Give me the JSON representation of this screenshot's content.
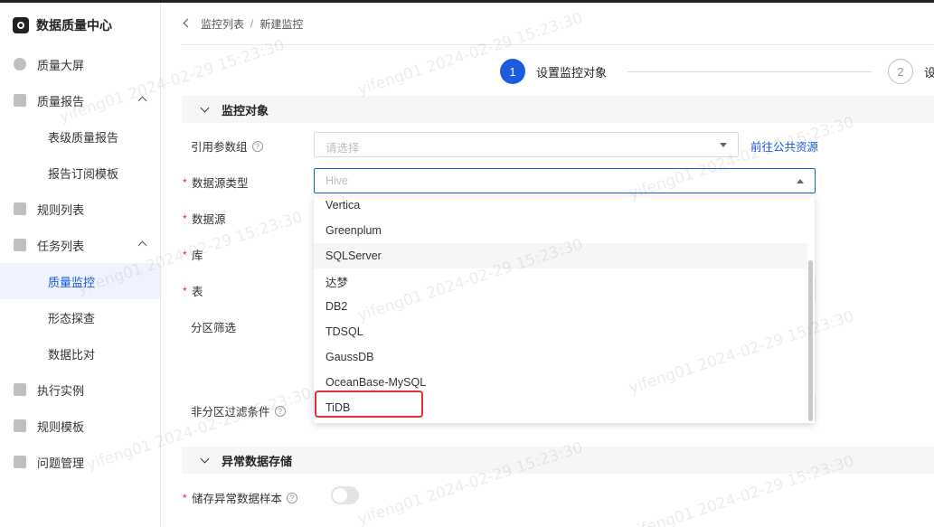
{
  "app": {
    "title": "数据质量中心"
  },
  "sidebar": {
    "items": [
      {
        "label": "质量大屏"
      },
      {
        "label": "质量报告"
      },
      {
        "label": "表级质量报告"
      },
      {
        "label": "报告订阅模板"
      },
      {
        "label": "规则列表"
      },
      {
        "label": "任务列表"
      },
      {
        "label": "质量监控"
      },
      {
        "label": "形态探查"
      },
      {
        "label": "数据比对"
      },
      {
        "label": "执行实例"
      },
      {
        "label": "规则模板"
      },
      {
        "label": "问题管理"
      }
    ]
  },
  "breadcrumb": {
    "parent": "监控列表",
    "separator": "/",
    "current": "新建监控"
  },
  "steps": [
    {
      "number": "1",
      "label": "设置监控对象"
    },
    {
      "number": "2",
      "label": "设"
    }
  ],
  "sections": {
    "monitor_object": "监控对象",
    "abnormal_storage": "异常数据存储"
  },
  "form": {
    "param_group": {
      "label": "引用参数组",
      "placeholder": "请选择",
      "link": "前往公共资源"
    },
    "datasource_type": {
      "label": "数据源类型",
      "value": "Hive"
    },
    "datasource": {
      "label": "数据源"
    },
    "database": {
      "label": "库"
    },
    "table": {
      "label": "表"
    },
    "partition": {
      "label": "分区筛选"
    },
    "non_partition_filter": {
      "label": "非分区过滤条件"
    },
    "store_samples": {
      "label": "储存异常数据样本"
    },
    "required_mark": "*",
    "help_mark": "?"
  },
  "dropdown": {
    "options": [
      "Vertica",
      "Greenplum",
      "SQLServer",
      "达梦",
      "DB2",
      "TDSQL",
      "GaussDB",
      "OceanBase-MySQL",
      "TiDB"
    ],
    "hovered": "SQLServer",
    "highlighted": "TiDB"
  },
  "watermark": "yifeng01 2024-02-29 15:23:30",
  "colors": {
    "primary": "#1a5cdd",
    "highlight": "#e0303a"
  }
}
